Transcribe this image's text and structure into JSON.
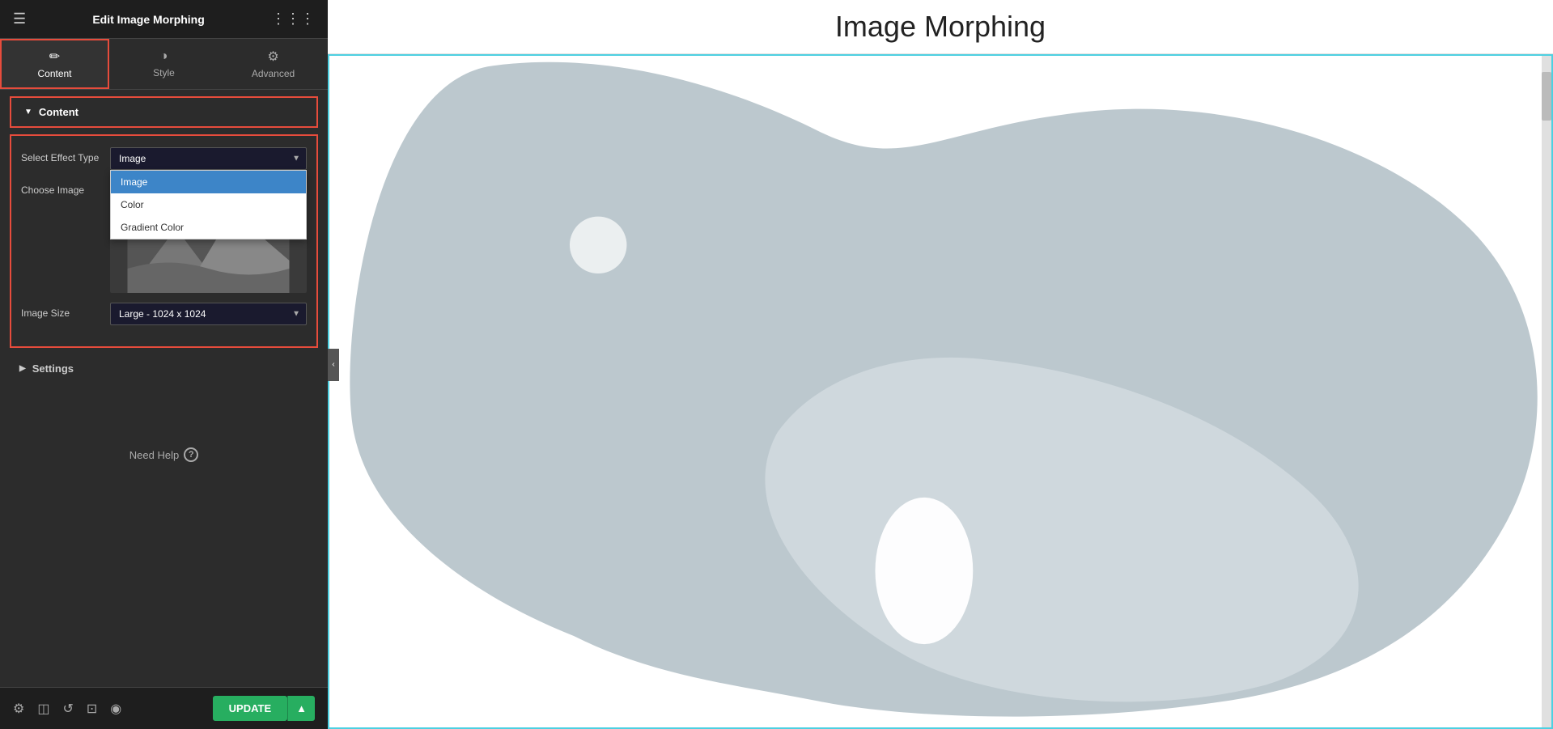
{
  "header": {
    "title": "Edit Image Morphing",
    "hamburger": "☰",
    "grid": "⋮⋮⋮"
  },
  "tabs": [
    {
      "id": "content",
      "label": "Content",
      "icon": "✏",
      "active": true
    },
    {
      "id": "style",
      "label": "Style",
      "icon": "◑",
      "active": false
    },
    {
      "id": "advanced",
      "label": "Advanced",
      "icon": "⚙",
      "active": false
    }
  ],
  "content_section": {
    "label": "Content",
    "arrow": "▼"
  },
  "fields": {
    "effect_type": {
      "label": "Select Effect Type",
      "selected": "Image",
      "options": [
        "Image",
        "Color",
        "Gradient Color"
      ]
    },
    "choose_image": {
      "label": "Choose Image"
    },
    "image_size": {
      "label": "Image Size",
      "selected": "Large - 1024 x 1024"
    }
  },
  "settings": {
    "label": "Settings",
    "arrow": "▶"
  },
  "need_help": {
    "text": "Need Help",
    "icon": "?"
  },
  "toolbar": {
    "update_label": "UPDATE",
    "icons": [
      "⚙",
      "◫",
      "↺",
      "⊡",
      "◉"
    ]
  },
  "page": {
    "title": "Image Morphing"
  },
  "collapse_arrow": "‹"
}
